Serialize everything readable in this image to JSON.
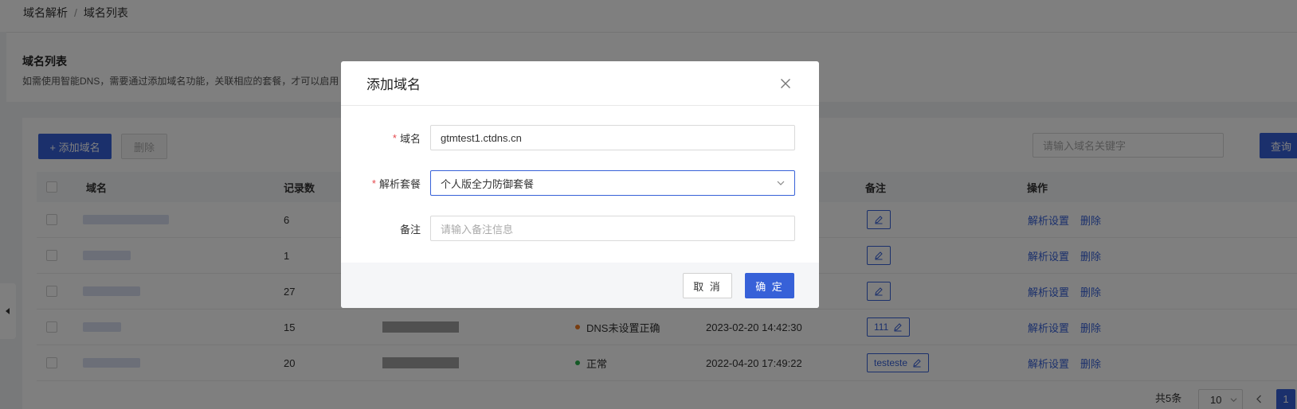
{
  "breadcrumb": {
    "root": "域名解析",
    "separator": "/",
    "current": "域名列表"
  },
  "header": {
    "title": "域名列表",
    "description": "如需使用智能DNS，需要通过添加域名功能，关联相应的套餐，才可以启用"
  },
  "toolbar": {
    "add_label": "+ 添加域名",
    "delete_label": "删除",
    "search_placeholder": "请输入域名关键字",
    "search_button": "查询"
  },
  "table": {
    "headers": {
      "domain": "域名",
      "records": "记录数",
      "note": "备注",
      "actions": "操作"
    },
    "rows": [
      {
        "records": "6",
        "status": "",
        "created": "",
        "note": "",
        "action_settings": "解析设置",
        "action_delete": "删除"
      },
      {
        "records": "1",
        "status": "",
        "created": "",
        "note": "",
        "action_settings": "解析设置",
        "action_delete": "删除"
      },
      {
        "records": "27",
        "status": "",
        "created": "",
        "note": "",
        "action_settings": "解析设置",
        "action_delete": "删除"
      },
      {
        "records": "15",
        "status": "DNS未设置正确",
        "created": "2023-02-20 14:42:30",
        "note": "111",
        "action_settings": "解析设置",
        "action_delete": "删除"
      },
      {
        "records": "20",
        "status": "正常",
        "created": "2022-04-20 17:49:22",
        "note": "testeste",
        "action_settings": "解析设置",
        "action_delete": "删除"
      }
    ]
  },
  "pagination": {
    "total": "共5条",
    "page_size": "10",
    "current_page": "1"
  },
  "colors": {
    "primary": "#3761d8",
    "status_warning": "#f07a22",
    "status_ok": "#2bb24c"
  },
  "modal": {
    "title": "添加域名",
    "close_icon": "close-icon",
    "fields": {
      "domain": {
        "label": "域名",
        "required": true,
        "value": "gtmtest1.ctdns.cn"
      },
      "package": {
        "label": "解析套餐",
        "required": true,
        "value": "个人版全力防御套餐"
      },
      "note": {
        "label": "备注",
        "required": false,
        "placeholder": "请输入备注信息"
      }
    },
    "cancel_label": "取 消",
    "ok_label": "确 定"
  }
}
